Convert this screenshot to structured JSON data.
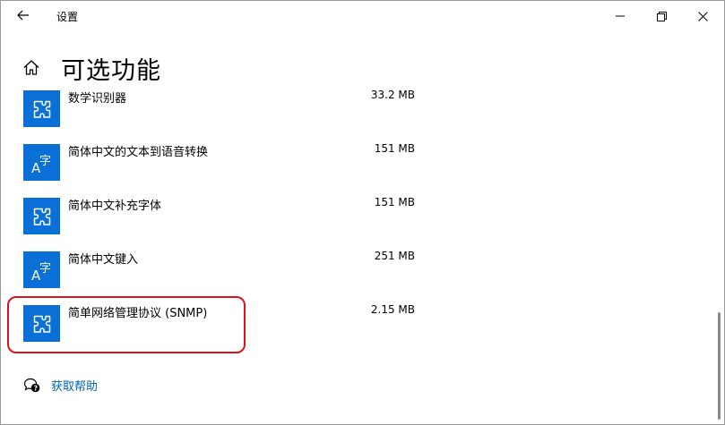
{
  "window": {
    "title": "设置"
  },
  "page": {
    "title": "可选功能"
  },
  "features": [
    {
      "name": "数学识别器",
      "size": "33.2 MB",
      "icon": "puzzle-icon"
    },
    {
      "name": "简体中文的文本到语音转换",
      "size": "151 MB",
      "icon": "language-icon"
    },
    {
      "name": "简体中文补充字体",
      "size": "151 MB",
      "icon": "puzzle-icon"
    },
    {
      "name": "简体中文键入",
      "size": "251 MB",
      "icon": "language-icon"
    },
    {
      "name": "简单网络管理协议 (SNMP)",
      "size": "2.15 MB",
      "icon": "puzzle-icon"
    }
  ],
  "help": {
    "label": "获取帮助"
  },
  "colors": {
    "accent": "#0a6fd6",
    "link": "#0063b1",
    "highlight": "#d9141c"
  }
}
